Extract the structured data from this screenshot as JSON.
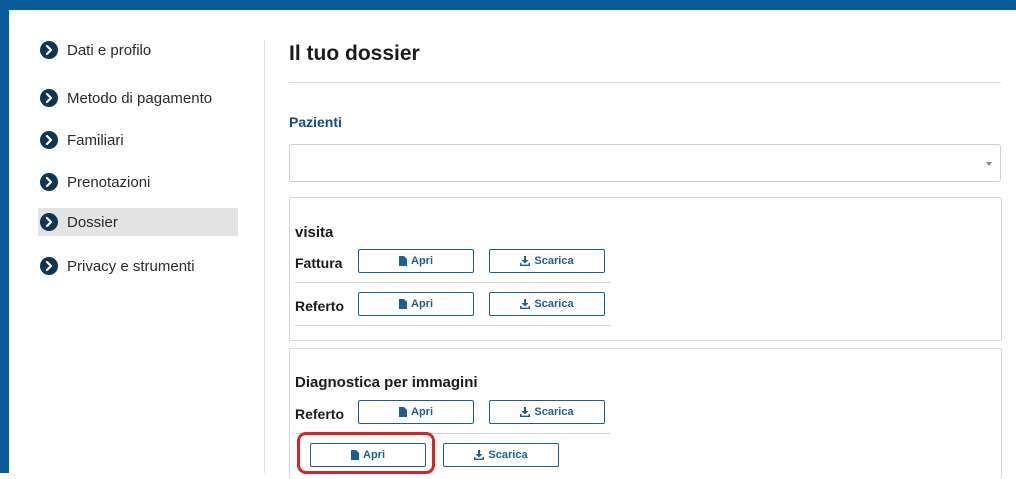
{
  "sidebar": {
    "items": [
      {
        "label": "Dati e profilo",
        "active": false
      },
      {
        "label": "Metodo di pagamento",
        "active": false
      },
      {
        "label": "Familiari",
        "active": false
      },
      {
        "label": "Prenotazioni",
        "active": false
      },
      {
        "label": "Dossier",
        "active": true
      },
      {
        "label": "Privacy e strumenti",
        "active": false
      }
    ]
  },
  "main": {
    "title": "Il tuo dossier",
    "patients_label": "Pazienti",
    "patients_select_value": "",
    "sections": [
      {
        "title": "visita",
        "rows": [
          {
            "label": "Fattura",
            "open_label": "Apri",
            "download_label": "Scarica"
          },
          {
            "label": "Referto",
            "open_label": "Apri",
            "download_label": "Scarica"
          }
        ]
      },
      {
        "title": "Diagnostica per immagini",
        "rows": [
          {
            "label": "Referto",
            "open_label": "Apri",
            "download_label": "Scarica"
          },
          {
            "label": "",
            "open_label": "Apri",
            "download_label": "Scarica",
            "highlighted": true
          }
        ]
      }
    ]
  },
  "colors": {
    "frame": "#0a5a9c",
    "accent": "#1d5f94",
    "sidebar_icon": "#0f3552",
    "active_bg": "#e3e3e3",
    "highlight": "#d8232a"
  },
  "icons": {
    "sidebar_bullet": "chevron-right-circle-icon",
    "open": "file-icon",
    "download": "download-icon",
    "select": "caret-down-icon"
  }
}
